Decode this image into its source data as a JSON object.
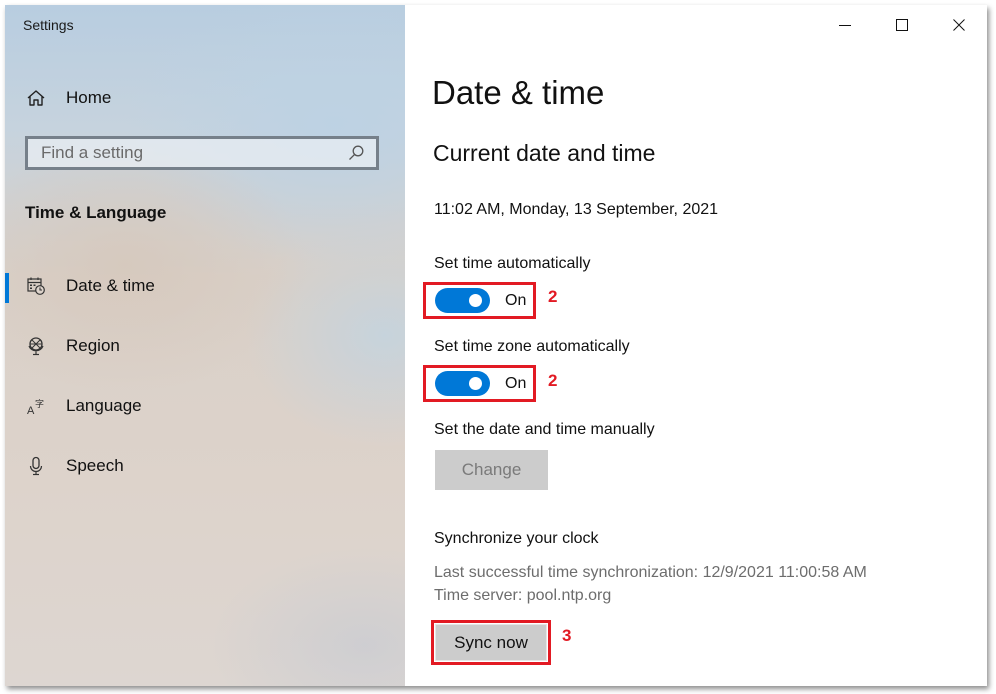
{
  "window": {
    "title": "Settings",
    "controls": {
      "minimize_icon": "minimize-icon",
      "maximize_icon": "maximize-icon",
      "close_icon": "close-icon"
    }
  },
  "sidebar": {
    "home": {
      "label": "Home",
      "icon": "home-icon"
    },
    "search": {
      "placeholder": "Find a setting",
      "value": "",
      "icon": "search-icon"
    },
    "section_title": "Time & Language",
    "items": [
      {
        "label": "Date & time",
        "icon": "calendar-clock-icon",
        "active": true
      },
      {
        "label": "Region",
        "icon": "globe-icon",
        "active": false
      },
      {
        "label": "Language",
        "icon": "language-icon",
        "active": false
      },
      {
        "label": "Speech",
        "icon": "microphone-icon",
        "active": false
      }
    ],
    "accent_color": "#0078d7"
  },
  "main": {
    "page_title": "Date & time",
    "section_title": "Current date and time",
    "current_datetime": "11:02 AM, Monday, 13 September, 2021",
    "set_time_auto": {
      "label": "Set time automatically",
      "state": "On",
      "enabled": true,
      "annotation": "2"
    },
    "set_timezone_auto": {
      "label": "Set time zone automatically",
      "state": "On",
      "enabled": true,
      "annotation": "2"
    },
    "manual": {
      "label": "Set the date and time manually",
      "button": "Change",
      "disabled": true
    },
    "sync": {
      "title": "Synchronize your clock",
      "last_sync": "Last successful time synchronization: 12/9/2021 11:00:58 AM",
      "server": "Time server: pool.ntp.org",
      "button": "Sync now",
      "annotation": "3"
    },
    "annotation_color": "#e21a23",
    "toggle_color": "#0078d7"
  }
}
